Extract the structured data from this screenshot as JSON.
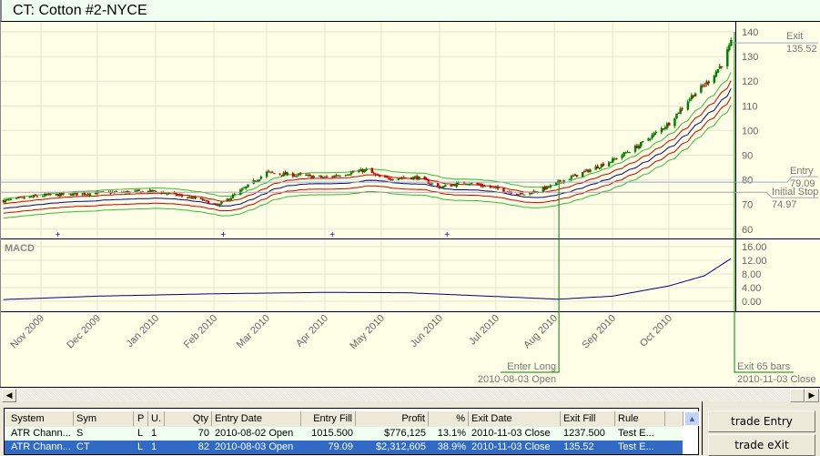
{
  "title": "CT: Cotton #2-NYCE",
  "colors": {
    "pane_bg": "#ffffe8",
    "up": "#008000",
    "down": "#cc0000",
    "center_band": "#00008b",
    "inner_band": "#cc0000",
    "outer_band": "#33bb33",
    "macd": "#000080",
    "trade_line": "#008000",
    "selected_row": "#316ac5"
  },
  "chart_data": {
    "type": "candlestick",
    "price_axis": {
      "ticks": [
        60,
        70,
        80,
        90,
        100,
        110,
        120,
        130,
        140
      ],
      "range": [
        57,
        142
      ]
    },
    "date_ticks": [
      "Nov 2009",
      "Dec 2009",
      "Jan 2010",
      "Feb 2010",
      "Mar 2010",
      "Apr 2010",
      "May 2010",
      "Jun 2010",
      "Jul 2010",
      "Aug 2010",
      "Sep 2010",
      "Oct 2010"
    ],
    "date_tick_dates": [
      "2009-11-01",
      "2009-12-01",
      "2010-01-01",
      "2010-02-01",
      "2010-03-01",
      "2010-04-01",
      "2010-05-01",
      "2010-06-01",
      "2010-07-01",
      "2010-08-01",
      "2010-09-01",
      "2010-10-01"
    ],
    "close_path": [
      [
        "2009-10-12",
        71.5
      ],
      [
        "2009-11-01",
        73.6
      ],
      [
        "2009-12-01",
        74.7
      ],
      [
        "2010-01-01",
        75.4
      ],
      [
        "2010-01-25",
        72
      ],
      [
        "2010-02-03",
        69.5
      ],
      [
        "2010-02-18",
        77
      ],
      [
        "2010-03-01",
        83
      ],
      [
        "2010-03-15",
        82
      ],
      [
        "2010-04-01",
        81
      ],
      [
        "2010-04-23",
        84
      ],
      [
        "2010-05-01",
        80.6
      ],
      [
        "2010-05-20",
        81
      ],
      [
        "2010-06-01",
        77
      ],
      [
        "2010-06-15",
        79
      ],
      [
        "2010-07-01",
        76.5
      ],
      [
        "2010-07-15",
        74
      ],
      [
        "2010-07-29",
        77
      ],
      [
        "2010-08-03",
        79
      ],
      [
        "2010-08-18",
        83.5
      ],
      [
        "2010-09-01",
        88
      ],
      [
        "2010-09-15",
        94
      ],
      [
        "2010-10-01",
        103
      ],
      [
        "2010-10-13",
        114
      ],
      [
        "2010-10-22",
        120
      ],
      [
        "2010-10-29",
        127
      ],
      [
        "2010-11-03",
        135.5
      ]
    ],
    "markers_dates": [
      "2009-11-10",
      "2010-02-06",
      "2010-04-05",
      "2010-06-05"
    ],
    "macd": {
      "label": "MACD",
      "ticks": [
        "16.00",
        "12.00",
        "8.00",
        "4.00",
        "0.00"
      ],
      "tick_values": [
        16,
        12,
        8,
        4,
        0
      ],
      "path": [
        [
          "2009-10-12",
          0.5
        ],
        [
          "2009-12-01",
          1.5
        ],
        [
          "2010-02-01",
          2.2
        ],
        [
          "2010-04-01",
          2.6
        ],
        [
          "2010-05-15",
          2.5
        ],
        [
          "2010-07-01",
          1.4
        ],
        [
          "2010-08-03",
          0.6
        ],
        [
          "2010-09-01",
          1.5
        ],
        [
          "2010-10-01",
          4.5
        ],
        [
          "2010-10-20",
          7.5
        ],
        [
          "2010-11-03",
          12.5
        ]
      ]
    },
    "annotations": {
      "exit": {
        "label": "Exit",
        "value": "135.52",
        "price": 135.52
      },
      "entry": {
        "label": "Entry",
        "value": "79.09",
        "price": 79.09
      },
      "stop": {
        "label": "Initial Stop",
        "value": "74.97",
        "price": 74.97
      },
      "enter_long": {
        "label": "Enter Long",
        "date_text": "2010-08-03 Open",
        "date": "2010-08-03"
      },
      "exit_bars": {
        "label": "Exit 65 bars",
        "date_text": "2010-11-03 Close",
        "date": "2010-11-03"
      }
    }
  },
  "table": {
    "headers": [
      "System",
      "Sym",
      "P",
      "U.",
      "Qty",
      "Entry Date",
      "Entry Fill",
      "Profit",
      "%",
      "Exit Date",
      "Exit Fill",
      "Rule"
    ],
    "rows": [
      [
        "ATR Chann...",
        "S",
        "L",
        "1",
        "70",
        "2010-08-02 Open",
        "1015.500",
        "$776,125",
        "13.1%",
        "2010-11-03 Close",
        "1237.500",
        "Test E..."
      ],
      [
        "ATR Chann...",
        "CT",
        "L",
        "1",
        "82",
        "2010-08-03 Open",
        "79.09",
        "$2,312,605",
        "38.9%",
        "2010-11-03 Close",
        "135.52",
        "Test E..."
      ]
    ]
  },
  "buttons": {
    "entry": "trade Entry",
    "exit": "trade eXit"
  }
}
